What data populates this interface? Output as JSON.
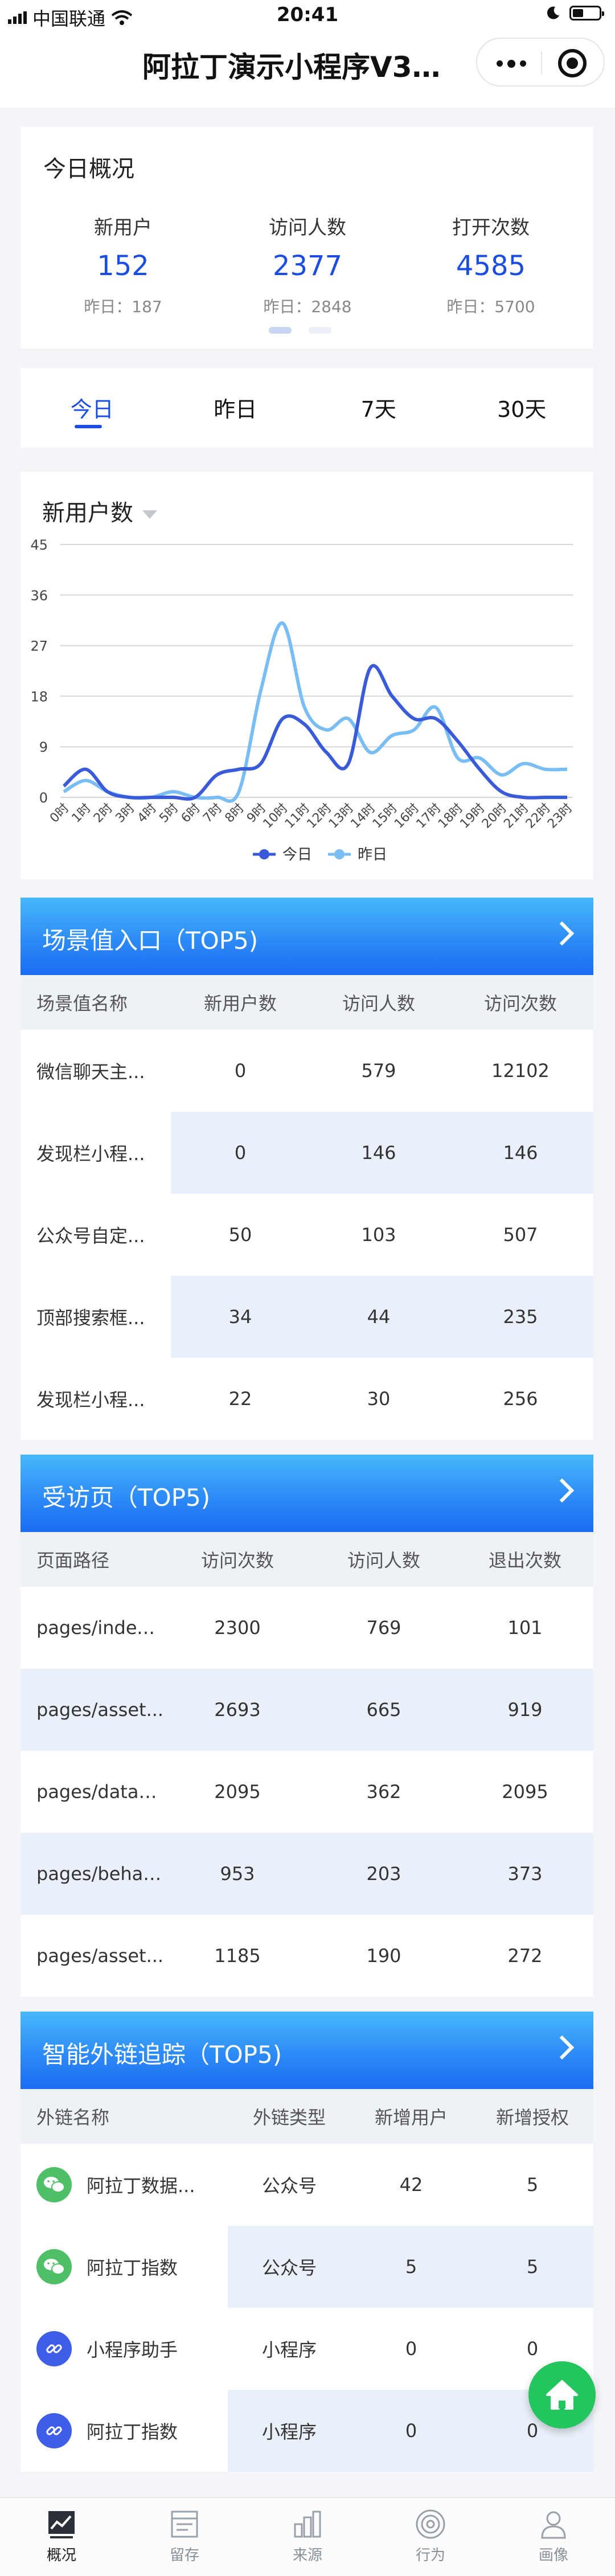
{
  "status_bar": {
    "carrier": "中国联通",
    "time": "20:41"
  },
  "nav": {
    "title": "阿拉丁演示小程序V3...."
  },
  "overview": {
    "title": "今日概况",
    "metrics": [
      {
        "label": "新用户",
        "value": "152",
        "yesterday": "昨日：187"
      },
      {
        "label": "访问人数",
        "value": "2377",
        "yesterday": "昨日：2848"
      },
      {
        "label": "打开次数",
        "value": "4585",
        "yesterday": "昨日：5700"
      }
    ]
  },
  "period_tabs": [
    "今日",
    "昨日",
    "7天",
    "30天"
  ],
  "chart_card": {
    "title": "新用户数"
  },
  "chart_data": {
    "type": "line",
    "x": [
      "0时",
      "1时",
      "2时",
      "3时",
      "4时",
      "5时",
      "6时",
      "7时",
      "8时",
      "9时",
      "10时",
      "11时",
      "12时",
      "13时",
      "14时",
      "15时",
      "16时",
      "17时",
      "18时",
      "19时",
      "20时",
      "21时",
      "22时",
      "23时"
    ],
    "ylim": [
      0,
      45
    ],
    "yticks": [
      "0",
      "9",
      "18",
      "27",
      "36",
      "45"
    ],
    "grid": true,
    "legend_position": "bottom",
    "series": [
      {
        "name": "今日",
        "color": "#3a5bd9",
        "values": [
          2,
          5,
          1,
          0,
          0,
          0,
          0,
          4,
          5,
          6,
          14,
          13,
          8,
          6,
          23,
          18,
          14,
          14,
          10,
          5,
          1,
          0,
          0,
          0
        ]
      },
      {
        "name": "昨日",
        "color": "#79bdf5",
        "values": [
          1,
          3,
          1,
          0,
          0,
          1,
          0,
          0,
          1,
          19,
          31,
          16,
          12,
          14,
          8,
          11,
          12,
          16,
          7,
          7,
          4,
          6,
          5,
          5
        ]
      }
    ]
  },
  "scene_table": {
    "title": "场景值入口（TOP5)",
    "columns": [
      "场景值名称",
      "新用户数",
      "访问人数",
      "访问次数"
    ],
    "rows": [
      [
        "微信聊天主...",
        "0",
        "579",
        "12102"
      ],
      [
        "发现栏小程...",
        "0",
        "146",
        "146"
      ],
      [
        "公众号自定...",
        "50",
        "103",
        "507"
      ],
      [
        "顶部搜索框...",
        "34",
        "44",
        "235"
      ],
      [
        "发现栏小程...",
        "22",
        "30",
        "256"
      ]
    ]
  },
  "page_table": {
    "title": "受访页（TOP5)",
    "columns": [
      "页面路径",
      "访问次数",
      "访问人数",
      "退出次数"
    ],
    "rows": [
      [
        "pages/index...",
        "2300",
        "769",
        "101"
      ],
      [
        "pages/asset...",
        "2693",
        "665",
        "919"
      ],
      [
        "pages/dataS...",
        "2095",
        "362",
        "2095"
      ],
      [
        "pages/behav...",
        "953",
        "203",
        "373"
      ],
      [
        "pages/asset...",
        "1185",
        "190",
        "272"
      ]
    ]
  },
  "link_table": {
    "title": "智能外链追踪（TOP5)",
    "columns": [
      "外链名称",
      "外链类型",
      "新增用户",
      "新增授权"
    ],
    "rows": [
      {
        "icon": "wechat-icon",
        "name": "阿拉丁数据...",
        "type": "公众号",
        "new_users": "42",
        "new_auth": "5"
      },
      {
        "icon": "wechat-icon",
        "name": "阿拉丁指数",
        "type": "公众号",
        "new_users": "5",
        "new_auth": "5"
      },
      {
        "icon": "link-icon",
        "name": "小程序助手",
        "type": "小程序",
        "new_users": "0",
        "new_auth": "0"
      },
      {
        "icon": "link-icon",
        "name": "阿拉丁指数",
        "type": "小程序",
        "new_users": "0",
        "new_auth": "0"
      }
    ]
  },
  "tabbar": [
    {
      "label": "概况",
      "icon": "overview-icon"
    },
    {
      "label": "留存",
      "icon": "retention-icon"
    },
    {
      "label": "来源",
      "icon": "source-icon"
    },
    {
      "label": "行为",
      "icon": "behavior-icon"
    },
    {
      "label": "画像",
      "icon": "portrait-icon"
    }
  ],
  "colors": {
    "accent": "#1b4de4",
    "header_gradient": "#2d8bf6",
    "fab": "#22c55e"
  }
}
